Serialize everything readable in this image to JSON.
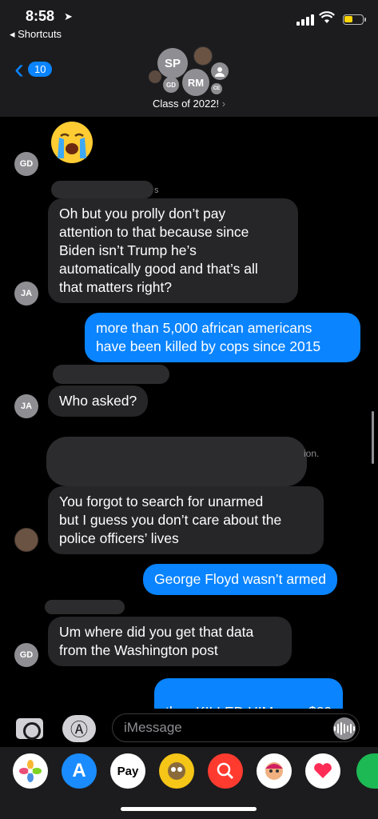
{
  "status_bar": {
    "time": "8:58",
    "back_app": "◂ Shortcuts",
    "battery_color": "#ffd60a"
  },
  "header": {
    "back_count": "10",
    "avatars": [
      "SP",
      "RM",
      "GD",
      "CE"
    ],
    "group_name": "Class of 2022!",
    "group_chevron": "›"
  },
  "messages": [
    {
      "kind": "received",
      "sender_initials": "GD",
      "emoji": "loudly-crying-face"
    },
    {
      "kind": "received",
      "sender_initials": "JA",
      "text": "Oh but you prolly don’t pay\nattention to that because since\nBiden isn’t Trump  he’s\nautomatically good and that’s all\nthat matters right?"
    },
    {
      "kind": "sent",
      "text": "more than 5,000 african americans\nhave been killed by cops since 2015"
    },
    {
      "kind": "received",
      "sender_initials": "JA",
      "text": "Who asked?"
    },
    {
      "kind": "received",
      "sender_initials": "",
      "sender_photo": true,
      "text": "You forgot to search for unarmed\nbut I guess you don’t care about the\npolice officers’ lives"
    },
    {
      "kind": "sent",
      "text": "George Floyd wasn’t armed"
    },
    {
      "kind": "received",
      "sender_initials": "GD",
      "text": "Um where did you get that data\nfrom the Washington post"
    },
    {
      "kind": "sent",
      "text_prefix": "they KILLED HIM over ",
      "link": "$20"
    }
  ],
  "partial_text": {
    "fragment_1": "s",
    "fragment_2": "ion."
  },
  "input": {
    "placeholder": "iMessage"
  },
  "drawer": {
    "apple_pay_label": "Pay",
    "apps": [
      "photos-icon",
      "app-store-icon",
      "apple-pay-icon",
      "memoji-icon",
      "web-search-icon",
      "memoji-sticker-icon",
      "digital-touch-icon",
      "spotify-icon"
    ]
  },
  "colors": {
    "accent": "#0a84ff",
    "received_bubble": "#262629",
    "background": "#000000"
  }
}
